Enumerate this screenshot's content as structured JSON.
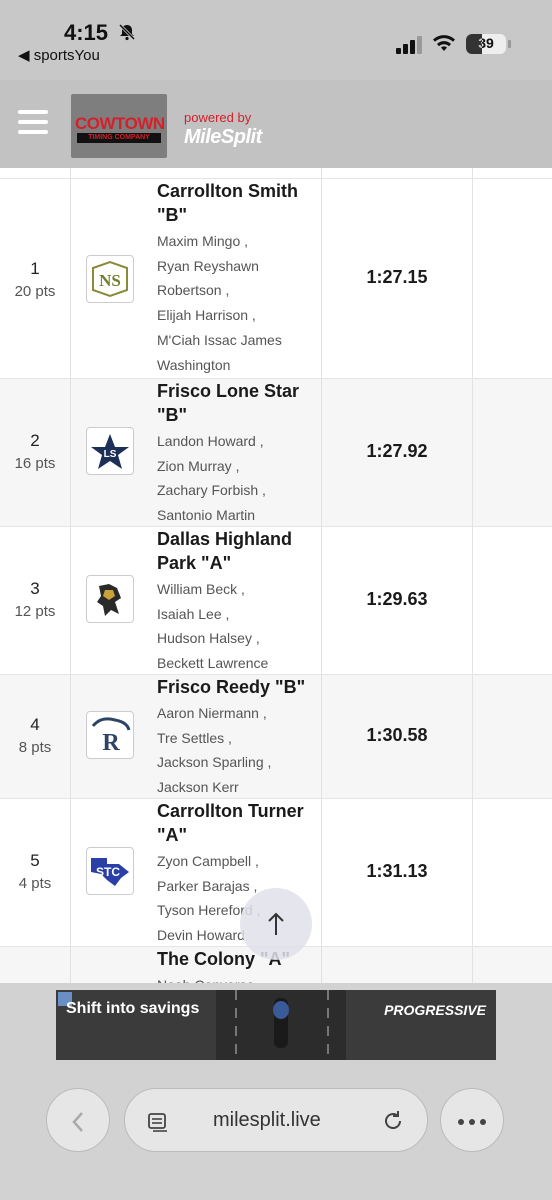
{
  "status_bar": {
    "time": "4:15",
    "back_label": "◀ sportsYou",
    "battery": "39"
  },
  "header": {
    "logo_text": "COWTOWN",
    "logo_subtext": "TIMING COMPANY",
    "powered_by": "powered by",
    "brand": "MileSplit"
  },
  "results": [
    {
      "place": "1",
      "points": "20 pts",
      "team": "Carrollton Smith \"B\"",
      "athletes": [
        "Maxim Mingo ,",
        "Ryan Reyshawn",
        "Robertson ,",
        "Elijah Harrison ,",
        "M'Ciah Issac James",
        "Washington"
      ],
      "mark": "1:27.15",
      "logo_icon": "ns-team-logo-icon"
    },
    {
      "place": "2",
      "points": "16 pts",
      "team": "Frisco Lone Star \"B\"",
      "athletes": [
        "Landon Howard ,",
        "Zion Murray ,",
        "Zachary Forbish ,",
        "Santonio Martin"
      ],
      "mark": "1:27.92",
      "logo_icon": "lone-star-logo-icon"
    },
    {
      "place": "3",
      "points": "12 pts",
      "team": "Dallas Highland Park \"A\"",
      "athletes": [
        "William Beck ,",
        "Isaiah Lee ,",
        "Hudson Halsey ,",
        "Beckett Lawrence"
      ],
      "mark": "1:29.63",
      "logo_icon": "highland-park-logo-icon"
    },
    {
      "place": "4",
      "points": "8 pts",
      "team": "Frisco Reedy \"B\"",
      "athletes": [
        "Aaron Niermann ,",
        "Tre Settles ,",
        "Jackson Sparling ,",
        "Jackson Kerr"
      ],
      "mark": "1:30.58",
      "logo_icon": "reedy-logo-icon"
    },
    {
      "place": "5",
      "points": "4 pts",
      "team": "Carrollton Turner \"A\"",
      "athletes": [
        "Zyon Campbell ,",
        "Parker Barajas ,",
        "Tyson Hereford ,",
        "Devin Howard"
      ],
      "mark": "1:31.13",
      "logo_icon": "turner-logo-icon"
    },
    {
      "place": "",
      "points": "",
      "team": "The Colony \"A\"",
      "athletes": [
        "Noah Converse ,"
      ],
      "mark": "",
      "logo_icon": ""
    }
  ],
  "ad": {
    "text": "Shift into savings",
    "brand": "PROGRESSIVE"
  },
  "browser": {
    "url": "milesplit.live"
  }
}
